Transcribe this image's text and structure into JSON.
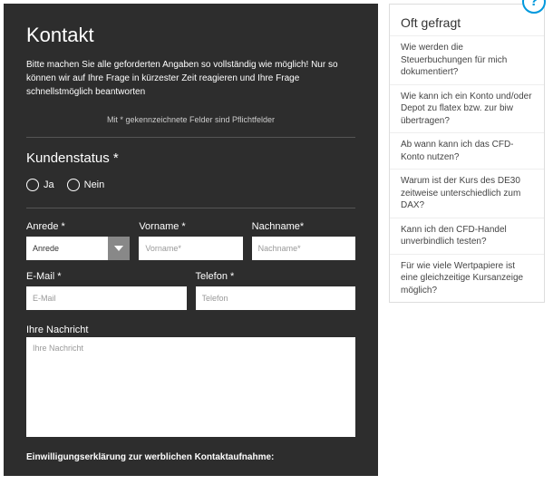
{
  "form": {
    "title": "Kontakt",
    "intro": "Bitte machen Sie alle geforderten Angaben so vollständig wie möglich! Nur so können wir auf Ihre Frage in kürzester Zeit reagieren und Ihre Frage schnellstmöglich beantworten",
    "required_note": "Mit * gekennzeichnete Felder sind Pflichtfelder",
    "customer_status_label": "Kundenstatus *",
    "radio_yes": "Ja",
    "radio_no": "Nein",
    "salutation_label": "Anrede *",
    "salutation_value": "Anrede",
    "firstname_label": "Vorname *",
    "firstname_placeholder": "Vorname*",
    "lastname_label": "Nachname*",
    "lastname_placeholder": "Nachname*",
    "email_label": "E-Mail *",
    "email_placeholder": "E-Mail",
    "phone_label": "Telefon *",
    "phone_placeholder": "Telefon",
    "message_label": "Ihre Nachricht",
    "message_placeholder": "Ihre Nachricht",
    "consent_heading": "Einwilligungserklärung zur werblichen Kontaktaufnahme:"
  },
  "sidebar": {
    "title": "Oft gefragt",
    "faqs": {
      "i0": "Wie werden die Steuerbuchungen für mich dokumentiert?",
      "i1": "Wie kann ich ein Konto und/oder Depot zu flatex bzw. zur biw übertragen?",
      "i2": "Ab wann kann ich das CFD-Konto nutzen?",
      "i3": "Warum ist der Kurs des DE30 zeitweise unterschiedlich zum DAX?",
      "i4": "Kann ich den CFD-Handel unverbindlich testen?",
      "i5": "Für wie viele Wertpapiere ist eine gleichzeitige Kursanzeige möglich?"
    }
  }
}
